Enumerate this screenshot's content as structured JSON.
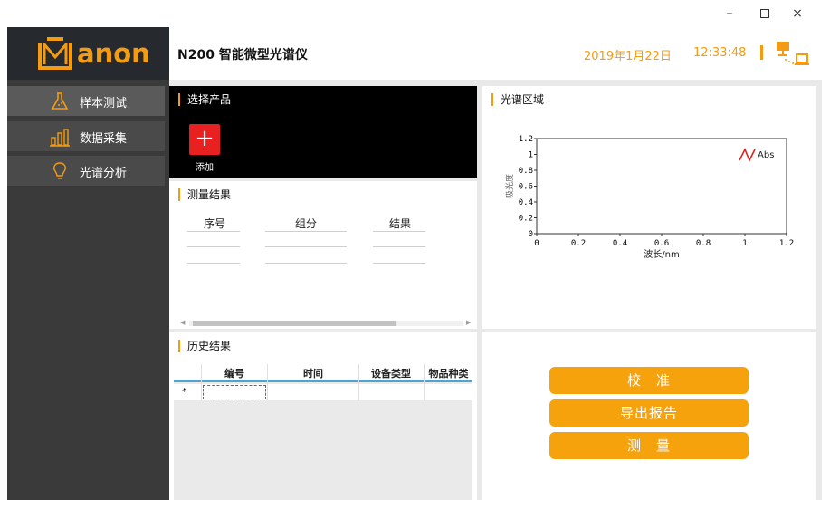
{
  "window": {
    "minimize": "–",
    "close": "×"
  },
  "brand": {
    "name": "anon",
    "accent": "#f39c12"
  },
  "header": {
    "title": "N200 智能微型光谱仪",
    "date": "2019年1月22日",
    "time": "12:33:48",
    "network_icon": "network-computer-icon"
  },
  "sidebar": {
    "items": [
      {
        "label": "样本测试",
        "icon": "flask-icon",
        "active": true
      },
      {
        "label": "数据采集",
        "icon": "bar-chart-icon",
        "active": false
      },
      {
        "label": "光谱分析",
        "icon": "lightbulb-icon",
        "active": false
      }
    ]
  },
  "select_panel": {
    "title": "选择产品",
    "add_symbol": "+",
    "add_label": "添加"
  },
  "measure_panel": {
    "title": "测量结果",
    "columns": [
      "序号",
      "组分",
      "结果"
    ]
  },
  "history_panel": {
    "title": "历史结果",
    "columns": [
      "编号",
      "时间",
      "设备类型",
      "物品种类"
    ],
    "new_row_marker": "*"
  },
  "spectrum_panel": {
    "title": "光谱区域"
  },
  "chart_data": {
    "type": "line",
    "title": "",
    "xlabel": "波长/nm",
    "ylabel": "吸光度",
    "xlim": [
      0,
      1.2
    ],
    "ylim": [
      0,
      1.2
    ],
    "x_ticks": [
      "0",
      "0.2",
      "0.4",
      "0.6",
      "0.8",
      "1",
      "1.2"
    ],
    "y_ticks": [
      "0",
      "0.2",
      "0.4",
      "0.6",
      "0.8",
      "1",
      "1.2"
    ],
    "series": [
      {
        "name": "Abs",
        "values": [],
        "color": "#e0201f"
      }
    ],
    "legend": "top-right",
    "grid": false
  },
  "actions": {
    "calibrate": "校　准",
    "export": "导出报告",
    "measure": "测　量"
  }
}
